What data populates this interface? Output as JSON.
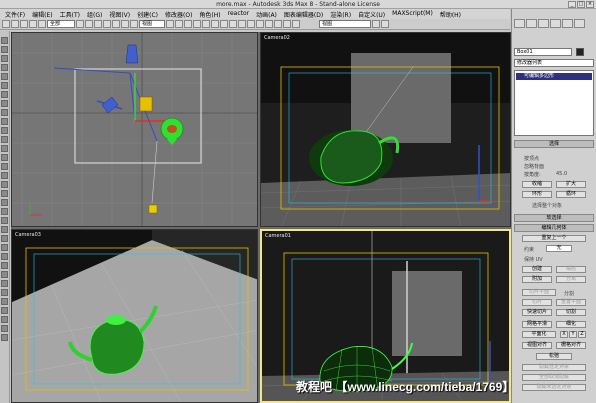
{
  "window": {
    "title": "more.max - Autodesk 3ds Max 8 - Stand-alone License"
  },
  "menu": [
    "文件(F)",
    "编辑(E)",
    "工具(T)",
    "组(G)",
    "视图(V)",
    "创建(C)",
    "修改器(O)",
    "角色(H)",
    "reactor",
    "动画(A)",
    "图表编辑器(D)",
    "渲染(R)",
    "自定义(U)",
    "MAXScript(M)",
    "帮助(H)"
  ],
  "toolbar": {
    "selection_filter": "全部",
    "ref_coord": "视图",
    "named_selection": "视图"
  },
  "viewports": {
    "top_left": {
      "label": ""
    },
    "top_right": {
      "label": "Camera02"
    },
    "bottom_left": {
      "label": "Camera03"
    },
    "bottom_right": {
      "label": "Camera01"
    }
  },
  "command_panel": {
    "tabs": [
      "",
      "",
      "",
      "",
      "",
      ""
    ],
    "object_name": "Box01",
    "object_color": "#222222",
    "modifier_list": "修改器列表",
    "stack": [
      "可编辑多边形"
    ],
    "selection_rollout": "选择",
    "selection": {
      "by_vertex": "按顶点",
      "ignore_back": "忽略背面",
      "by_angle": "按角度:",
      "angle_value": "45.0",
      "shrink": "收缩",
      "grow": "扩大",
      "ring": "环形",
      "loop": "循环",
      "selected": "选择整个对象"
    },
    "soft_selection": "软选择",
    "edit_geometry": "编辑几何体",
    "repeat_last": "重复上一个",
    "constraints": "约束",
    "constraints_value": "无",
    "preserve_uv": "保持 UV",
    "create": "创建",
    "collapse": "塌陷",
    "attach": "附加",
    "detach": "分离",
    "slice_plane": "切片平面",
    "split": "分割",
    "slice": "切片",
    "reset_plane": "重置平面",
    "quickslice": "快速切片",
    "cut": "切割",
    "msmooth": "网格平滑",
    "tessellate": "细化",
    "make_planar": "平面化",
    "x": "X",
    "y": "Y",
    "z": "Z",
    "view_align": "视图对齐",
    "grid_align": "栅格对齐",
    "relax": "松弛",
    "hide_selected": "隐藏选定对象",
    "unhide_all": "全部取消隐藏",
    "hide_unselected": "隐藏未选定对象"
  },
  "watermark": "教程吧 【www.linecg.com/tieba/1769】"
}
